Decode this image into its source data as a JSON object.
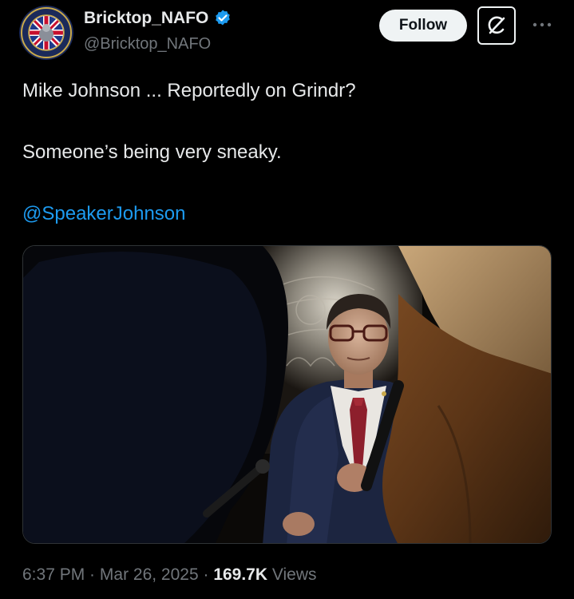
{
  "author": {
    "display_name": "Bricktop_NAFO",
    "handle": "@Bricktop_NAFO",
    "verified": true,
    "avatar_icon": "nafo-union-jack-badge-icon"
  },
  "actions": {
    "follow_label": "Follow",
    "grok_icon": "grok-icon",
    "more_icon": "more-dots-icon"
  },
  "tweet": {
    "line1": "Mike Johnson ... Reportedly on Grindr?",
    "line2": "Someone’s being very sneaky.",
    "mention": "@SpeakerJohnson"
  },
  "media": {
    "kind": "photo",
    "subject": "man-in-suit-glasses-red-tie"
  },
  "meta": {
    "time": "6:37 PM",
    "separator1": " · ",
    "date": "Mar 26, 2025",
    "separator2": " · ",
    "views_count": "169.7K",
    "views_label": " Views"
  },
  "colors": {
    "background": "#000000",
    "text_primary": "#e7e9ea",
    "text_secondary": "#71767b",
    "link": "#1d9bf0",
    "verified_badge": "#1d9bf0",
    "follow_bg": "#eff3f4"
  }
}
